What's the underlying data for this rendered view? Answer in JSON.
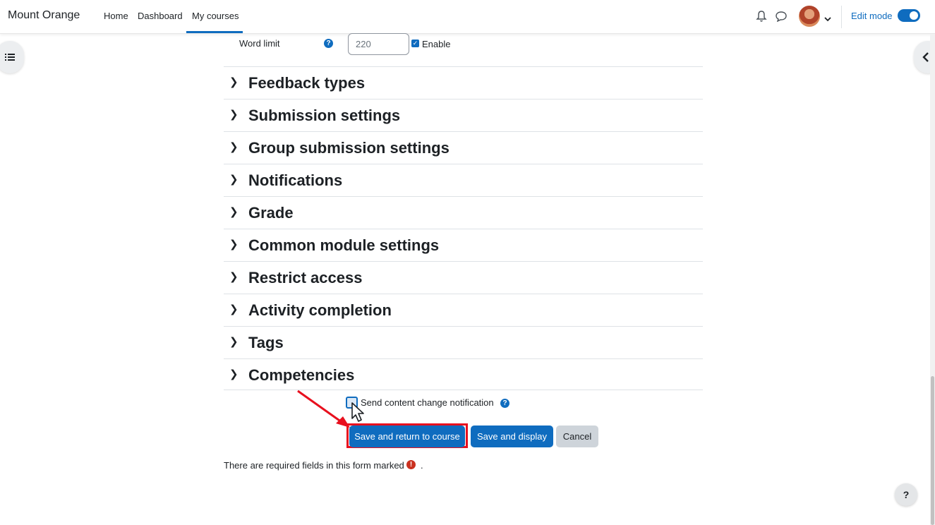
{
  "navbar": {
    "brand": "Mount Orange",
    "links": [
      "Home",
      "Dashboard",
      "My courses"
    ],
    "active_link": "My courses",
    "edit_mode_label": "Edit mode",
    "edit_mode_on": true
  },
  "form": {
    "word_limit": {
      "label": "Word limit",
      "value": "220",
      "enable_label": "Enable",
      "enabled": true
    },
    "sections": [
      "Feedback types",
      "Submission settings",
      "Group submission settings",
      "Notifications",
      "Grade",
      "Common module settings",
      "Restrict access",
      "Activity completion",
      "Tags",
      "Competencies"
    ],
    "notify_label": "Send content change notification",
    "buttons": {
      "save_return": "Save and return to course",
      "save_display": "Save and display",
      "cancel": "Cancel"
    },
    "required_text": "There are required fields in this form marked",
    "required_suffix": "."
  },
  "help_button": "?",
  "colors": {
    "primary": "#0f6cbf",
    "highlight": "#e8101e",
    "required": "#ca3120"
  }
}
